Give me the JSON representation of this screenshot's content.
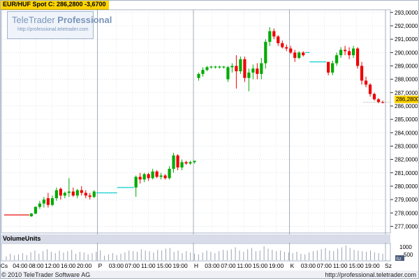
{
  "header": {
    "label": "EUR/HUF Spot C: 286,2800 -3,6700"
  },
  "logo": {
    "brand_main": "TeleTrader",
    "brand_bold": "Professional",
    "url": "http://professional.teletrader.com"
  },
  "last_price_label": "286,2800",
  "volume_panel": {
    "label": "VolumeUnits",
    "ticks": [
      "1000",
      "500"
    ],
    "corner_badge": "Sz"
  },
  "footer": {
    "copyright": "© 2010 TeleTrader Software AG",
    "url": "http://professional.teletrader.com"
  },
  "chart_data": {
    "type": "candlestick",
    "title": "EUR/HUF Spot C: 286,2800 -3,6700",
    "ylim": [
      276.5,
      293.2
    ],
    "y_ticks": [
      "293,0000",
      "292,0000",
      "291,0000",
      "290,0000",
      "289,0000",
      "288,0000",
      "287,0000",
      "286,0000",
      "285,0000",
      "284,0000",
      "283,0000",
      "282,0000",
      "281,0000",
      "280,0000",
      "279,0000",
      "278,0000",
      "277,0000"
    ],
    "x_tick_labels": [
      "Cs",
      "04:00",
      "08:00",
      "12:00",
      "16:00",
      "20:00",
      "P",
      "03:00",
      "07:00",
      "11:00",
      "15:00",
      "19:00",
      "H",
      "03:00",
      "07:00",
      "11:00",
      "15:00",
      "19:00",
      "K",
      "03:00",
      "07:00",
      "11:00",
      "15:00",
      "19:00",
      "Sz"
    ],
    "day_separators": [
      "Cs",
      "P",
      "H",
      "K",
      "Sz"
    ],
    "colors": {
      "up": "#00aa00",
      "down": "#ee0000",
      "flat": "#00cccc",
      "grid": "#c8d0dc",
      "axis_text": "#000000"
    },
    "candles": [
      [
        277.85,
        277.85,
        277.85,
        277.85
      ],
      [
        277.85,
        277.85,
        277.85,
        277.85
      ],
      [
        277.85,
        277.85,
        277.85,
        277.85
      ],
      [
        277.85,
        277.85,
        277.85,
        277.85
      ],
      [
        277.85,
        277.85,
        277.85,
        277.85
      ],
      [
        277.85,
        277.85,
        277.85,
        277.85
      ],
      [
        277.75,
        278.0,
        277.7,
        277.95
      ],
      [
        277.95,
        278.5,
        277.9,
        278.45
      ],
      [
        278.45,
        278.9,
        278.3,
        278.7
      ],
      [
        278.7,
        279.2,
        278.4,
        279.0
      ],
      [
        279.1,
        279.5,
        278.4,
        278.6
      ],
      [
        278.6,
        279.3,
        278.5,
        279.1
      ],
      [
        279.1,
        279.9,
        278.9,
        279.7
      ],
      [
        279.8,
        279.9,
        279.0,
        279.3
      ],
      [
        279.3,
        279.6,
        279.1,
        279.5
      ],
      [
        279.5,
        280.6,
        279.2,
        279.6
      ],
      [
        279.6,
        279.9,
        279.2,
        279.3
      ],
      [
        279.3,
        279.8,
        279.1,
        279.7
      ],
      [
        279.7,
        280.0,
        279.3,
        279.5
      ],
      [
        279.5,
        279.7,
        279.1,
        279.3
      ],
      [
        279.3,
        279.5,
        279.0,
        279.2
      ],
      [
        279.2,
        279.7,
        279.1,
        279.6
      ],
      [
        279.5,
        279.5,
        279.5,
        279.5
      ],
      [
        279.5,
        279.5,
        279.5,
        279.5
      ],
      [
        279.5,
        279.5,
        279.5,
        279.5
      ],
      [
        279.5,
        279.5,
        279.5,
        279.5
      ],
      [
        279.5,
        279.5,
        279.5,
        279.5
      ],
      [
        279.9,
        279.9,
        279.9,
        279.9
      ],
      [
        279.9,
        279.9,
        279.9,
        279.9
      ],
      [
        279.9,
        279.9,
        279.9,
        279.9
      ],
      [
        279.9,
        279.9,
        279.9,
        279.9
      ],
      [
        279.9,
        280.8,
        279.2,
        280.7
      ],
      [
        280.7,
        281.0,
        280.2,
        280.5
      ],
      [
        280.5,
        281.0,
        280.3,
        280.9
      ],
      [
        280.9,
        281.0,
        280.4,
        280.6
      ],
      [
        280.6,
        281.3,
        280.5,
        281.1
      ],
      [
        281.1,
        281.2,
        280.6,
        280.7
      ],
      [
        280.7,
        281.0,
        280.5,
        280.8
      ],
      [
        280.8,
        280.9,
        280.5,
        280.6
      ],
      [
        280.6,
        281.5,
        280.5,
        281.3
      ],
      [
        281.3,
        282.5,
        281.0,
        282.3
      ],
      [
        282.3,
        282.4,
        281.2,
        281.4
      ],
      [
        281.4,
        282.0,
        281.2,
        281.8
      ],
      [
        281.8,
        281.9,
        281.6,
        281.7
      ],
      [
        281.7,
        281.9,
        281.6,
        281.8
      ],
      [
        281.8,
        281.9,
        281.7,
        281.9
      ],
      [
        288.1,
        288.5,
        287.9,
        288.4
      ],
      [
        288.4,
        288.9,
        288.2,
        288.7
      ],
      [
        288.7,
        289.0,
        288.6,
        288.9
      ],
      [
        288.9,
        289.0,
        288.8,
        288.95
      ],
      [
        288.9,
        289.0,
        288.8,
        288.95
      ],
      [
        288.9,
        289.0,
        288.8,
        288.95
      ],
      [
        288.9,
        289.0,
        288.8,
        288.95
      ],
      [
        288.0,
        289.0,
        287.8,
        288.9
      ],
      [
        288.9,
        289.2,
        288.5,
        289.0
      ],
      [
        289.0,
        289.8,
        287.3,
        288.6
      ],
      [
        288.6,
        289.7,
        288.4,
        289.5
      ],
      [
        289.5,
        289.7,
        287.8,
        288.1
      ],
      [
        288.1,
        288.8,
        287.1,
        288.5
      ],
      [
        288.5,
        289.1,
        288.0,
        288.8
      ],
      [
        288.8,
        289.2,
        288.0,
        288.4
      ],
      [
        288.4,
        289.6,
        288.0,
        289.2
      ],
      [
        289.2,
        291.0,
        288.8,
        290.8
      ],
      [
        290.8,
        291.9,
        290.5,
        291.6
      ],
      [
        291.6,
        291.8,
        291.0,
        291.2
      ],
      [
        291.2,
        291.3,
        290.5,
        290.7
      ],
      [
        290.7,
        290.9,
        290.3,
        290.4
      ],
      [
        290.4,
        290.6,
        290.1,
        290.3
      ],
      [
        290.3,
        290.5,
        289.9,
        290.0
      ],
      [
        290.0,
        290.2,
        289.3,
        289.6
      ],
      [
        289.6,
        290.1,
        289.5,
        290.0
      ],
      [
        290.0,
        290.1,
        289.7,
        289.8
      ],
      [
        290.0,
        290.0,
        290.0,
        290.0
      ],
      [
        289.3,
        289.3,
        289.3,
        289.3
      ],
      [
        289.3,
        289.3,
        289.3,
        289.3
      ],
      [
        289.3,
        289.3,
        289.3,
        289.3
      ],
      [
        289.3,
        289.3,
        289.3,
        289.3
      ],
      [
        289.3,
        289.3,
        288.3,
        288.5
      ],
      [
        288.5,
        289.4,
        288.3,
        289.2
      ],
      [
        289.2,
        290.0,
        289.0,
        289.8
      ],
      [
        289.8,
        290.4,
        289.6,
        290.2
      ],
      [
        290.2,
        290.5,
        289.8,
        290.1
      ],
      [
        290.1,
        290.4,
        289.5,
        289.8
      ],
      [
        289.8,
        290.5,
        289.6,
        290.3
      ],
      [
        290.3,
        290.4,
        288.8,
        289.0
      ],
      [
        289.0,
        289.3,
        287.6,
        287.9
      ],
      [
        287.9,
        288.2,
        287.4,
        287.6
      ],
      [
        287.6,
        287.7,
        286.7,
        286.9
      ],
      [
        286.9,
        287.0,
        286.4,
        286.5
      ],
      [
        286.5,
        286.6,
        286.2,
        286.3
      ],
      [
        286.3,
        286.4,
        286.2,
        286.28
      ]
    ],
    "volumes": [
      12,
      20,
      15,
      18,
      22,
      16,
      25,
      30,
      20,
      28,
      34,
      26,
      22,
      30,
      24,
      28,
      32,
      20,
      26,
      24,
      18,
      22,
      26,
      30,
      14,
      18,
      22,
      16,
      20,
      24,
      30,
      28,
      26,
      34,
      30,
      28,
      24,
      32,
      30,
      36,
      38,
      26,
      30,
      22,
      28,
      24,
      20,
      18,
      24,
      30,
      26,
      22,
      28,
      32,
      30,
      34,
      40,
      30,
      26,
      34,
      38,
      28,
      30,
      44,
      36,
      32,
      28,
      30,
      26,
      24,
      22,
      26,
      20,
      18,
      24,
      28,
      30,
      34,
      38,
      30,
      28,
      36,
      40,
      46,
      38,
      32,
      30,
      28,
      26,
      30,
      24,
      22,
      20
    ]
  }
}
